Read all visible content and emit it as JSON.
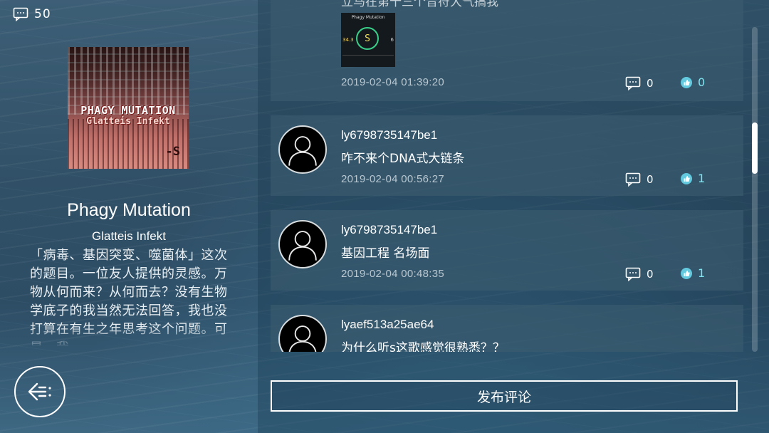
{
  "song": {
    "comment_count": "50",
    "cover_title_line1": "PHAGY MUTATION",
    "cover_title_line2": "Glatteis Infekt",
    "title": "Phagy Mutation",
    "artist": "Glatteis Infekt",
    "description": "「病毒、基因突变、噬菌体」这次的题目。一位友人提供的灵感。万物从何而来？从何而去？没有生物学底子的我当然无法回答，我也没打算在有生之年思考这个问题。可是，我"
  },
  "comments": [
    {
      "text": "立马在第十三个音符大气搞我",
      "thumb_title": "Phagy Mutation",
      "thumb_center": "S",
      "thumb_left_value": "34.3",
      "thumb_right_value": "6",
      "time": "2019-02-04 01:39:20",
      "replies": "0",
      "likes": "0"
    },
    {
      "username": "ly6798735147be1",
      "text": "咋不来个DNA式大链条",
      "time": "2019-02-04 00:56:27",
      "replies": "0",
      "likes": "1"
    },
    {
      "username": "ly6798735147be1",
      "text": "基因工程 名场面",
      "time": "2019-02-04 00:48:35",
      "replies": "0",
      "likes": "1"
    },
    {
      "username": "lyaef513a25ae64",
      "text": "为什么听s这歌感觉很熟悉？？"
    }
  ],
  "post_button_label": "发布评论",
  "icons": [
    "comment-icon",
    "thumbs-up-icon",
    "back-arrow-icon",
    "user-avatar-icon"
  ],
  "colors": {
    "like_accent": "#7fe4f0",
    "panel": "#3c5c70",
    "ring_green": "#3ad08a"
  },
  "scroll_position": 0.3
}
